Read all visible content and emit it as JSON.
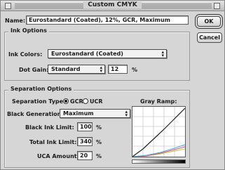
{
  "window": {
    "title": "Custom CMYK"
  },
  "name_field": {
    "label": "Name:",
    "value": "Eurostandard (Coated), 12%, GCR, Maximum"
  },
  "buttons": {
    "ok": "OK",
    "cancel": "Cancel"
  },
  "ink_options": {
    "title": "Ink Options",
    "ink_colors_label": "Ink Colors:",
    "ink_colors_value": "Eurostandard (Coated)",
    "dot_gain_label": "Dot Gain:",
    "dot_gain_mode": "Standard",
    "dot_gain_value": "12",
    "percent": "%"
  },
  "separation_options": {
    "title": "Separation Options",
    "separation_type_label": "Separation Type:",
    "gcr_label": "GCR",
    "ucr_label": "UCR",
    "selected_type": "GCR",
    "black_generation_label": "Black Generation:",
    "black_generation_value": "Maximum",
    "black_ink_limit_label": "Black Ink Limit:",
    "black_ink_limit_value": "100",
    "total_ink_limit_label": "Total Ink Limit:",
    "total_ink_limit_value": "340",
    "uca_amount_label": "UCA Amount:",
    "uca_amount_value": "20",
    "percent": "%",
    "gray_ramp_label": "Gray Ramp:"
  },
  "colors": {
    "cyan": "#3ab0d8",
    "magenta": "#d84a8a",
    "yellow": "#c9c23a",
    "black": "#222222"
  }
}
